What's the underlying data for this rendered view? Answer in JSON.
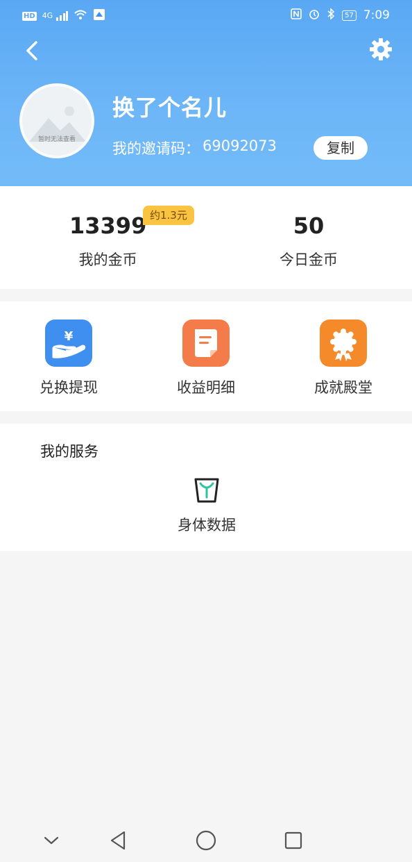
{
  "status_bar": {
    "hd": "HD",
    "network": "4G",
    "battery": "57",
    "time": "7:09"
  },
  "profile": {
    "avatar_placeholder": "暂时无法查看",
    "username": "换了个名儿",
    "invite_label": "我的邀请码：",
    "invite_code": "69092073",
    "copy_label": "复制"
  },
  "coins": {
    "my_value": "13399",
    "my_approx": "约1.3元",
    "my_label": "我的金币",
    "today_value": "50",
    "today_label": "今日金币"
  },
  "menu": {
    "items": [
      {
        "label": "兑换提现",
        "color": "#3f8ff0"
      },
      {
        "label": "收益明细",
        "color": "#f47c4a"
      },
      {
        "label": "成就殿堂",
        "color": "#f58a2a"
      }
    ]
  },
  "services": {
    "title": "我的服务",
    "items": [
      {
        "label": "身体数据"
      }
    ]
  },
  "colors": {
    "header_blue": "#5aa8f4",
    "approx_badge": "#f9c441",
    "scale_icon_green": "#2fc3a0"
  }
}
